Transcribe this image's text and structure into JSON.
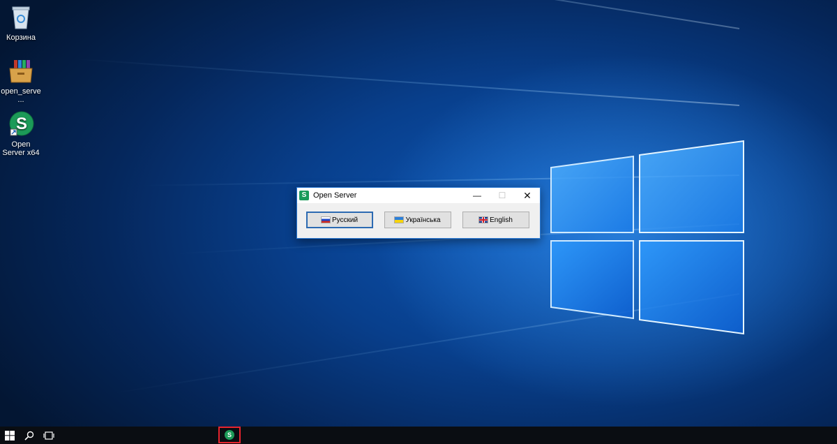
{
  "desktop": {
    "icons": [
      {
        "label": "Корзина",
        "icon": "recycle-bin-icon"
      },
      {
        "label": "open_serve...",
        "icon": "archive-installer-icon"
      },
      {
        "label": "Open Server x64",
        "icon": "open-server-icon"
      }
    ]
  },
  "dialog": {
    "title": "Open Server",
    "app_icon_letter": "S",
    "controls": {
      "minimize": "—",
      "maximize": "☐",
      "close": "✕"
    },
    "buttons": [
      {
        "label": "Русский",
        "flag": "russia-flag-icon"
      },
      {
        "label": "Українська",
        "flag": "ukraine-flag-icon"
      },
      {
        "label": "English",
        "flag": "uk-flag-icon"
      }
    ],
    "focused_button": "Русский"
  },
  "taskbar": {
    "start": "windows-start-icon",
    "search": "search-icon",
    "task_view": "task-view-icon",
    "open_server_letter": "S",
    "highlight_color": "#e8242e"
  }
}
